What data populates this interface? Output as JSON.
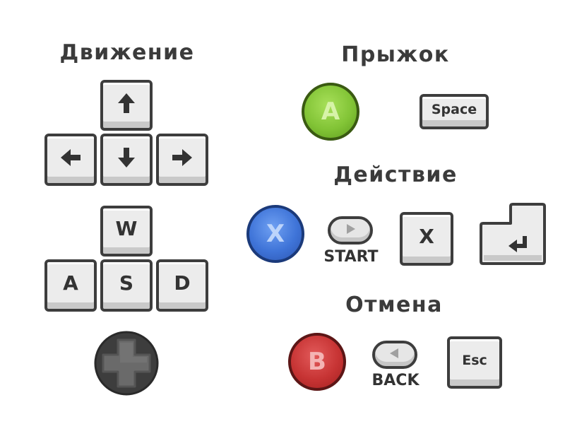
{
  "colors": {
    "heading": "#3b3b3b",
    "key_face": "#ececec",
    "key_outline": "#3d3d3d",
    "button_a": "#82c436",
    "button_x": "#3f74d8",
    "button_b": "#c73434",
    "dpad": "#5a5a5a"
  },
  "movement": {
    "title": "Движение",
    "arrow_keys": {
      "up_icon": "arrow-up-icon",
      "left_icon": "arrow-left-icon",
      "down_icon": "arrow-down-icon",
      "right_icon": "arrow-right-icon"
    },
    "letter_keys": {
      "w": "W",
      "a": "A",
      "s": "S",
      "d": "D"
    },
    "gamepad_icon": "dpad-icon"
  },
  "jump": {
    "title": "Прыжок",
    "gamepad_button": "A",
    "key": "Space"
  },
  "action": {
    "title": "Действие",
    "gamepad_button": "X",
    "start_caption": "START",
    "start_icon": "play-triangle-icon",
    "key": "X",
    "enter_icon": "enter-return-icon"
  },
  "cancel": {
    "title": "Отмена",
    "gamepad_button": "B",
    "back_caption": "BACK",
    "back_icon": "back-triangle-icon",
    "key": "Esc"
  }
}
